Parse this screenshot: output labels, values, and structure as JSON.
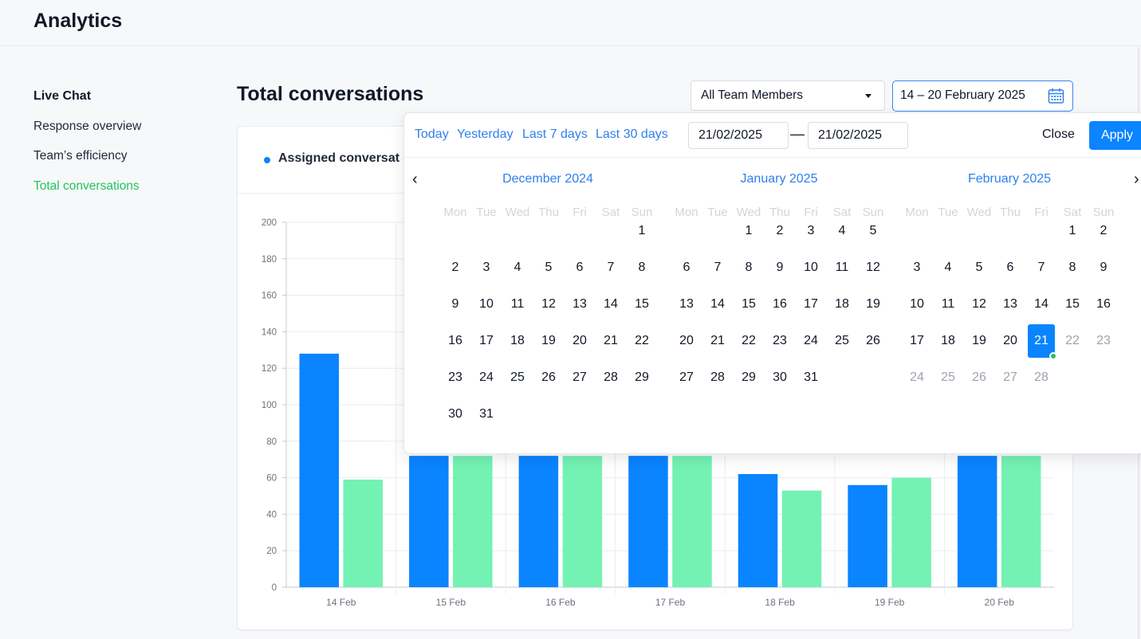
{
  "app": {
    "title": "Analytics"
  },
  "sidebar": {
    "heading": "Live Chat",
    "items": [
      {
        "label": "Response overview",
        "active": false
      },
      {
        "label": "Team’s efficiency",
        "active": false
      },
      {
        "label": "Total conversations",
        "active": true
      }
    ]
  },
  "main": {
    "title": "Total conversations",
    "team_select": {
      "value": "All Team Members"
    },
    "date_range": {
      "value": "14 – 20 February 2025"
    }
  },
  "legend": {
    "label": "Assigned conversat"
  },
  "chart_data": {
    "type": "bar",
    "categories": [
      "14 Feb",
      "15 Feb",
      "16 Feb",
      "17 Feb",
      "18 Feb",
      "19 Feb",
      "20 Feb"
    ],
    "series": [
      {
        "color": "#0a84ff",
        "values": [
          128,
          null,
          null,
          null,
          62,
          56,
          null
        ],
        "visible_min": [
          null,
          72,
          72,
          72,
          null,
          null,
          72
        ]
      },
      {
        "color": "#74f2b3",
        "values": [
          59,
          null,
          null,
          null,
          53,
          60,
          null
        ],
        "visible_min": [
          null,
          72,
          72,
          72,
          null,
          null,
          72
        ]
      }
    ],
    "ylim": [
      0,
      200
    ],
    "yticks": [
      0,
      20,
      40,
      60,
      80,
      100,
      120,
      140,
      160,
      180,
      200
    ],
    "grid": true
  },
  "picker": {
    "quick": [
      "Today",
      "Yesterday",
      "Last 7 days",
      "Last 30 days"
    ],
    "start": "21/02/2025",
    "end": "21/02/2025",
    "separator": "—",
    "close": "Close",
    "apply": "Apply",
    "weekdays": [
      "Mon",
      "Tue",
      "Wed",
      "Thu",
      "Fri",
      "Sat",
      "Sun"
    ],
    "months": [
      {
        "title": "December 2024",
        "start_offset": 6,
        "days": 31,
        "muted_from": null
      },
      {
        "title": "January 2025",
        "start_offset": 2,
        "days": 31,
        "muted_from": null
      },
      {
        "title": "February 2025",
        "start_offset": 5,
        "days": 28,
        "muted_from": 22
      }
    ],
    "selected": {
      "month": 2,
      "day": 21
    }
  },
  "icons": {
    "prev": "chevron-left-icon",
    "next": "chevron-right-icon",
    "calendar": "calendar-icon",
    "caret": "caret-down-icon"
  },
  "colors": {
    "accent": "#0a84ff",
    "link": "#2f80ed",
    "active": "#22c55e",
    "bar_blue": "#0a84ff",
    "bar_green": "#74f2b3"
  }
}
